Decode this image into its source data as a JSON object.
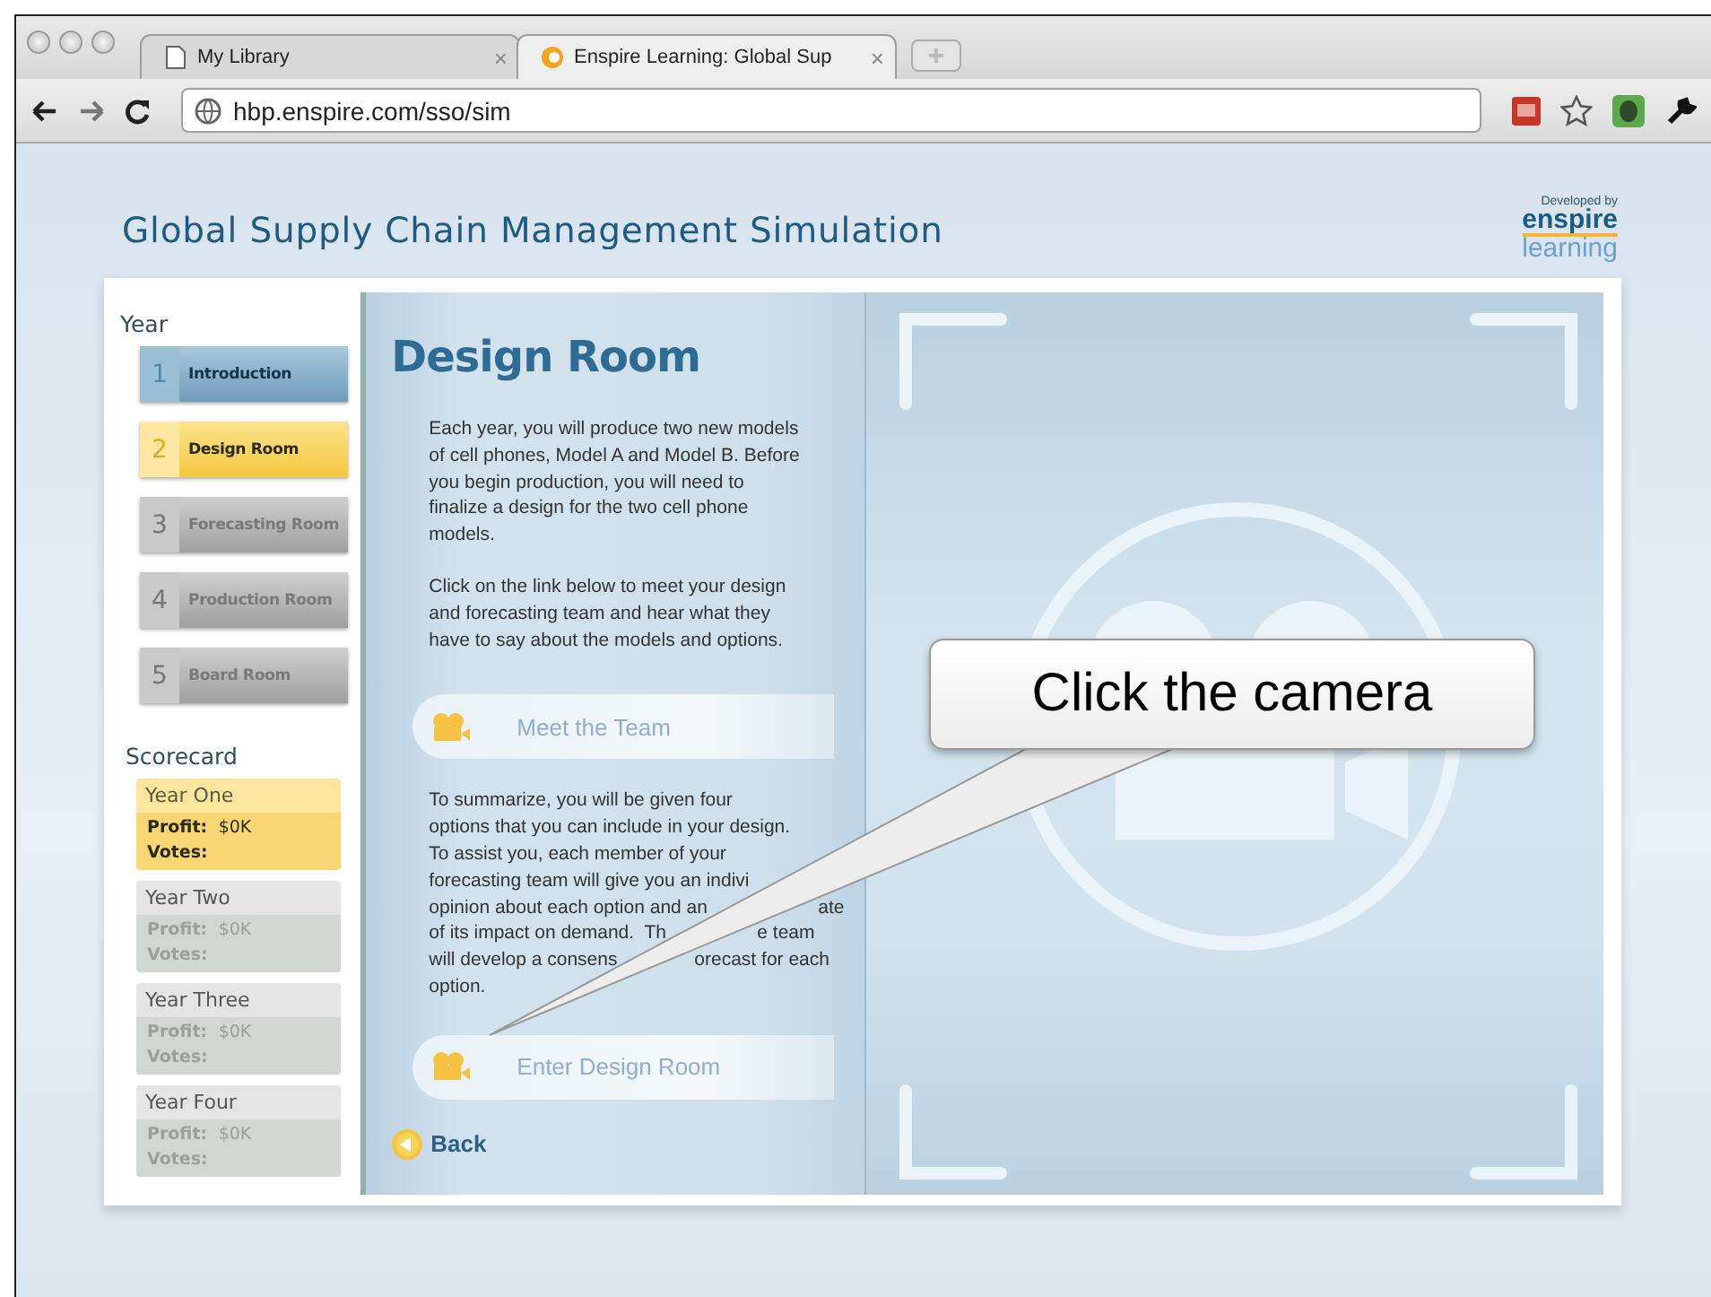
{
  "browser": {
    "tabs": [
      {
        "title": "My Library",
        "close": "×",
        "selected": false
      },
      {
        "title": "Enspire Learning: Global Sup",
        "close": "×",
        "selected": true
      }
    ],
    "url": "hbp.enspire.com/sso/sim"
  },
  "header": {
    "title": "Global Supply Chain Management Simulation",
    "logo": {
      "tagline": "Developed by",
      "brand": "enspire",
      "sub": "learning"
    }
  },
  "sidebar": {
    "year_heading": "Year",
    "rooms": [
      {
        "number": "1",
        "label": "Introduction",
        "selected": false,
        "disabled": false
      },
      {
        "number": "2",
        "label": "Design Room",
        "selected": true,
        "disabled": false
      },
      {
        "number": "3",
        "label": "Forecasting Room",
        "selected": false,
        "disabled": true
      },
      {
        "number": "4",
        "label": "Production Room",
        "selected": false,
        "disabled": true
      },
      {
        "number": "5",
        "label": "Board Room",
        "selected": false,
        "disabled": true
      }
    ],
    "scorecard_heading": "Scorecard",
    "scorecards": [
      {
        "title": "Year One",
        "profit_label": "Profit:",
        "profit": "$0K",
        "votes_label": "Votes:",
        "active": true
      },
      {
        "title": "Year Two",
        "profit_label": "Profit:",
        "profit": "$0K",
        "votes_label": "Votes:",
        "active": false
      },
      {
        "title": "Year Three",
        "profit_label": "Profit:",
        "profit": "$0K",
        "votes_label": "Votes:",
        "active": false
      },
      {
        "title": "Year Four",
        "profit_label": "Profit:",
        "profit": "$0K",
        "votes_label": "Votes:",
        "active": false
      }
    ]
  },
  "content": {
    "heading": "Design Room",
    "paragraphs": [
      "Each year, you will produce two new models of cell phones, Model A and Model B. Before you begin production, you will need to finalize a design for the two cell phone models.",
      "Click on the link below to meet your design and forecasting team and hear what they have to say about the models and options."
    ],
    "team_link": "Meet the Team",
    "summary_lines": [
      [
        "To summarize, you will be given four"
      ],
      [
        "options that you can include in your design."
      ],
      [
        "To assist you, each member of your"
      ],
      [
        "forecasting team will give you an indivi"
      ],
      [
        "opinion about each option and an",
        "ate"
      ],
      [
        "of its impact on demand.  Th",
        "e team"
      ],
      [
        "will develop a consens",
        "orecast for each"
      ],
      [
        "option."
      ]
    ],
    "enter_link": "Enter Design Room",
    "back": "Back"
  },
  "callout": {
    "text": "Click the camera"
  }
}
